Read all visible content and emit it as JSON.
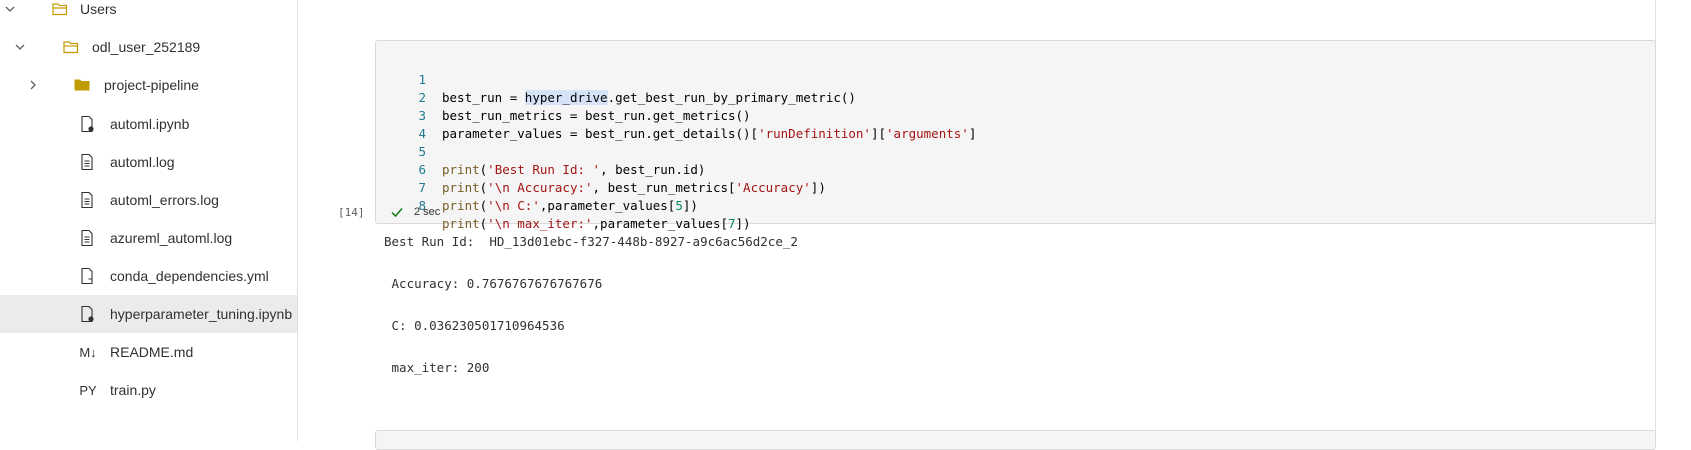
{
  "sidebar": {
    "items": [
      {
        "label": "Users",
        "icon": "folder-open-icon"
      },
      {
        "label": "odl_user_252189",
        "icon": "folder-open-icon"
      },
      {
        "label": "project-pipeline",
        "icon": "folder-icon"
      },
      {
        "label": "automl.ipynb",
        "icon": "notebook-icon"
      },
      {
        "label": "automl.log",
        "icon": "text-file-icon"
      },
      {
        "label": "automl_errors.log",
        "icon": "text-file-icon"
      },
      {
        "label": "azureml_automl.log",
        "icon": "text-file-icon"
      },
      {
        "label": "conda_dependencies.yml",
        "icon": "yml-file-icon"
      },
      {
        "label": "hyperparameter_tuning.ipynb",
        "icon": "notebook-icon"
      },
      {
        "label": "README.md",
        "icon_text": "M↓"
      },
      {
        "label": "train.py",
        "icon_text": "PY"
      }
    ]
  },
  "cell": {
    "line_numbers": [
      "1",
      "2",
      "3",
      "4",
      "5",
      "6",
      "7",
      "8"
    ],
    "code": {
      "l1_a": "best_run = ",
      "l1_hl": "hyper_drive",
      "l1_b": ".get_best_run_by_primary_metric()",
      "l2": "best_run_metrics = best_run.get_metrics()",
      "l3_a": "parameter_values = best_run.get_details()[",
      "l3_s1": "'runDefinition'",
      "l3_b": "][",
      "l3_s2": "'arguments'",
      "l3_c": "]",
      "l5_fn": "print",
      "l5_a": "(",
      "l5_s": "'Best Run Id: '",
      "l5_b": ", best_run.id)",
      "l6_fn": "print",
      "l6_a": "(",
      "l6_s1": "'\\n Accuracy:'",
      "l6_b": ", best_run_metrics[",
      "l6_s2": "'Accuracy'",
      "l6_c": "])",
      "l7_fn": "print",
      "l7_a": "(",
      "l7_s": "'\\n C:'",
      "l7_b": ",parameter_values[",
      "l7_n": "5",
      "l7_c": "])",
      "l8_fn": "print",
      "l8_a": "(",
      "l8_s": "'\\n max_iter:'",
      "l8_b": ",parameter_values[",
      "l8_n": "7",
      "l8_c": "])"
    },
    "exec_count": "[14]",
    "duration": "2 sec"
  },
  "output": {
    "lines": [
      "Best Run Id:  HD_13d01ebc-f327-448b-8927-a9c6ac56d2ce_2",
      " Accuracy: 0.7676767676767676",
      " C: 0.036230501710964536",
      " max_iter: 200"
    ]
  },
  "colors": {
    "folder": "#c19c00",
    "line_number": "#237893",
    "string": "#a31515",
    "success": "#107c10"
  }
}
